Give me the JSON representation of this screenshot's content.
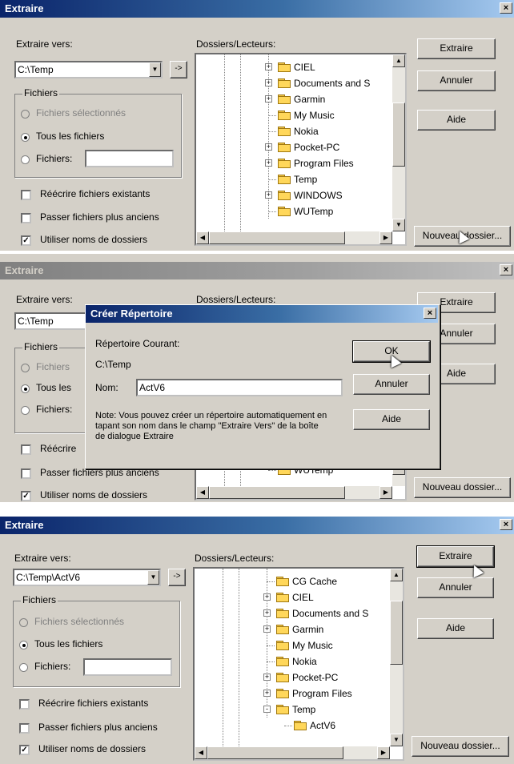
{
  "panel1": {
    "title": "Extraire",
    "close": "×",
    "extract_to_label": "Extraire vers:",
    "extract_to_value": "C:\\Temp",
    "folders_label": "Dossiers/Lecteurs:",
    "files_group": "Fichiers",
    "radio_selected": "Fichiers sélectionnés",
    "radio_all": "Tous les fichiers",
    "radio_files": "Fichiers:",
    "files_value": "",
    "chk_overwrite": "Réécrire fichiers existants",
    "chk_skip_older": "Passer fichiers plus anciens",
    "chk_use_folder_names": "Utiliser noms de dossiers",
    "btn_extract": "Extraire",
    "btn_cancel": "Annuler",
    "btn_help": "Aide",
    "btn_new_folder": "Nouveau dossier...",
    "tree": [
      "CIEL",
      "Documents and S",
      "Garmin",
      "My Music",
      "Nokia",
      "Pocket-PC",
      "Program Files",
      "Temp",
      "WINDOWS",
      "WUTemp"
    ],
    "checks": [
      false,
      false,
      true
    ],
    "radio": "all"
  },
  "panel2": {
    "title": "Extraire",
    "close": "×",
    "extract_to_label": "Extraire vers:",
    "extract_to_value": "C:\\Temp",
    "folders_label": "Dossiers/Lecteurs:",
    "files_group": "Fichiers",
    "radio_selected": "Fichiers",
    "radio_all": "Tous les",
    "radio_files": "Fichiers:",
    "chk_overwrite": "Réécrire",
    "chk_skip_older": "Passer fichiers plus anciens",
    "chk_use_folder_names": "Utiliser noms de dossiers",
    "btn_extract": "Extraire",
    "btn_cancel": "Annuler",
    "btn_help": "Aide",
    "btn_new_folder": "Nouveau dossier...",
    "tree_last": "WUTemp",
    "dialog": {
      "title": "Créer Répertoire",
      "close": "×",
      "current_dir_label": "Répertoire Courant:",
      "current_dir_value": "C:\\Temp",
      "name_label": "Nom:",
      "name_value": "ActV6",
      "note": "Note: Vous pouvez créer un répertoire automatiquement en tapant son nom dans le champ \"Extraire Vers\" de la boîte de dialogue Extraire",
      "btn_ok": "OK",
      "btn_cancel": "Annuler",
      "btn_help": "Aide"
    }
  },
  "panel3": {
    "title": "Extraire",
    "close": "×",
    "extract_to_label": "Extraire vers:",
    "extract_to_value": "C:\\Temp\\ActV6",
    "folders_label": "Dossiers/Lecteurs:",
    "files_group": "Fichiers",
    "radio_selected": "Fichiers sélectionnés",
    "radio_all": "Tous les fichiers",
    "radio_files": "Fichiers:",
    "chk_overwrite": "Réécrire fichiers existants",
    "chk_skip_older": "Passer fichiers plus anciens",
    "chk_use_folder_names": "Utiliser noms de dossiers",
    "btn_extract": "Extraire",
    "btn_cancel": "Annuler",
    "btn_help": "Aide",
    "btn_new_folder": "Nouveau dossier...",
    "tree": [
      "CG Cache",
      "CIEL",
      "Documents and S",
      "Garmin",
      "My Music",
      "Nokia",
      "Pocket-PC",
      "Program Files",
      "Temp",
      "ActV6"
    ],
    "checks": [
      false,
      false,
      true
    ],
    "radio": "all"
  },
  "icons": {
    "folder": "folder-icon",
    "expand": "plus-box-icon",
    "collapse": "minus-box-icon",
    "arrow_cursor": "mouse-cursor-icon",
    "dropdown": "chevron-down-icon"
  },
  "colors": {
    "titlebar_active": "#0a246a",
    "titlebar_inactive": "#808080",
    "face": "#d4d0c8",
    "folder": "#ffd75a"
  }
}
